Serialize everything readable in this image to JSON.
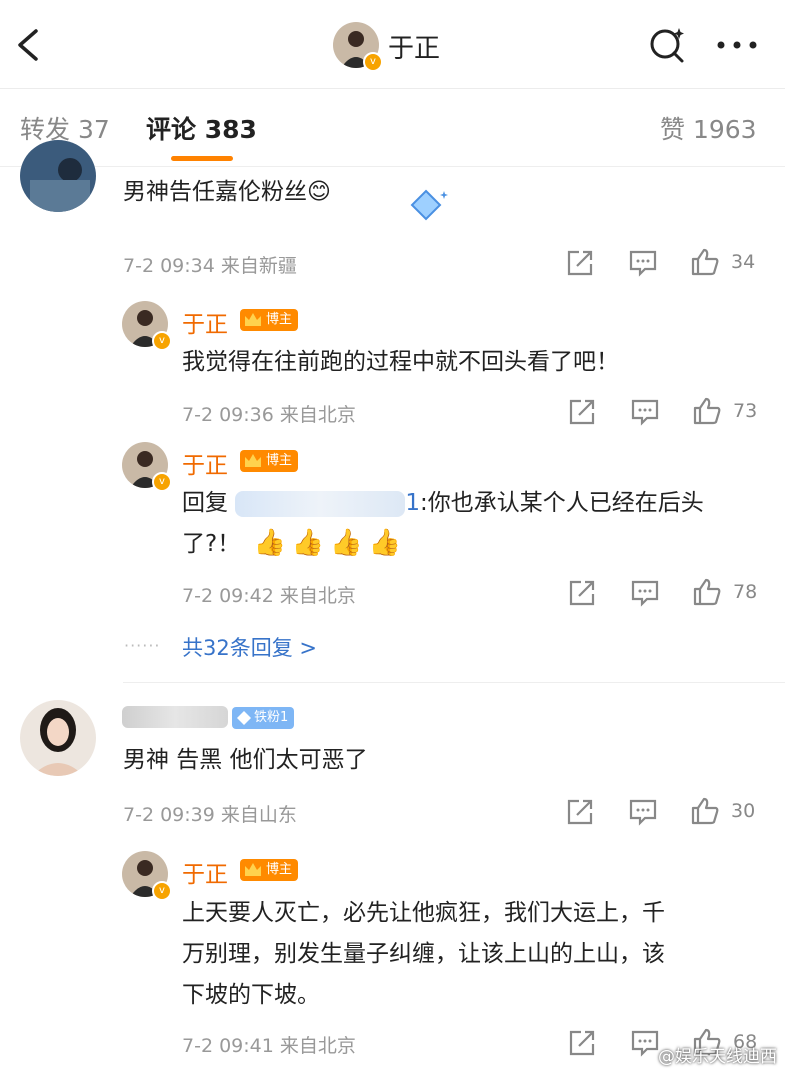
{
  "header": {
    "title": "于正",
    "back_icon": "chevron-left-icon",
    "search_icon": "search-sparkle-icon",
    "more_icon": "more-horizontal-icon"
  },
  "tabs": [
    {
      "label": "转发",
      "count": "37"
    },
    {
      "label": "评论",
      "count": "383"
    },
    {
      "label": "赞",
      "count": "1963"
    }
  ],
  "accent_color": "#ff8200",
  "comments": [
    {
      "text": "男神告任嘉伦粉丝😊",
      "time": "7-2 09:34",
      "location": "来自新疆",
      "likes": "34",
      "replies": [
        {
          "name": "于正",
          "badge": "博主",
          "text": "我觉得在往前跑的过程中就不回头看了吧！",
          "time": "7-2 09:36",
          "location": "来自北京",
          "likes": "73"
        },
        {
          "name": "于正",
          "badge": "博主",
          "text_prefix": "回复",
          "text_mention_tail": "1",
          "text": ":你也承认某个人已经在后头",
          "text_line2": "了?！",
          "time": "7-2 09:42",
          "location": "来自北京",
          "likes": "78"
        }
      ],
      "more_replies": "共32条回复 >"
    },
    {
      "fan_badge": "铁粉1",
      "text": "男神 告黑 他们太可恶了",
      "time": "7-2 09:39",
      "location": "来自山东",
      "likes": "30",
      "replies": [
        {
          "name": "于正",
          "badge": "博主",
          "line1": "上天要人灭亡，必先让他疯狂，我们大运上，千",
          "line2": "万别理，别发生量子纠缠，让该上山的上山，该",
          "line3": "下坡的下坡。",
          "time": "7-2 09:41",
          "location": "来自北京",
          "likes": "68"
        }
      ]
    }
  ],
  "watermark": "@娱乐天线迪西"
}
